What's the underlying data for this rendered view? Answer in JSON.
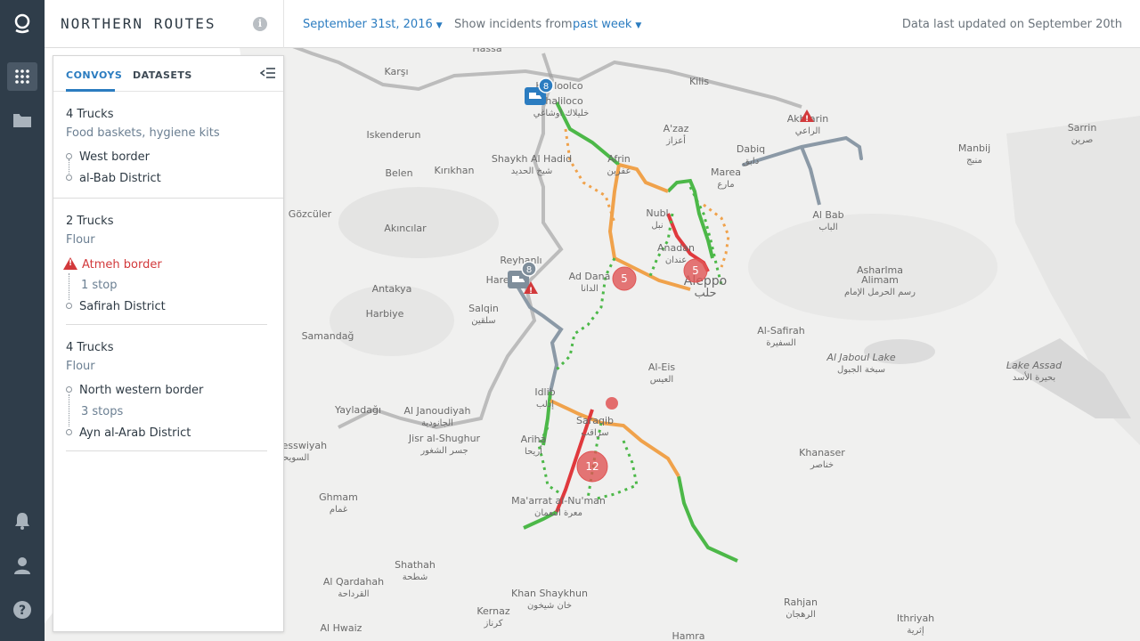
{
  "app": {
    "title": "NORTHERN ROUTES",
    "date_filter": "September 31st, 2016",
    "incidents_label": "Show incidents from",
    "incidents_filter": "past week",
    "last_updated": "Data last updated on September 20th"
  },
  "rail": {
    "items": [
      {
        "name": "logo-icon"
      },
      {
        "name": "grid-icon",
        "active": true
      },
      {
        "name": "folder-icon"
      },
      {
        "name": "bell-icon"
      },
      {
        "name": "user-icon"
      },
      {
        "name": "help-icon"
      }
    ]
  },
  "panel": {
    "tabs": [
      "CONVOYS",
      "DATASETS"
    ],
    "active_tab": "CONVOYS",
    "convoys": [
      {
        "trucks": "4 Trucks",
        "cargo": "Food baskets, hygiene kits",
        "from": "West border",
        "stops": "",
        "to": "al-Bab District",
        "alert": false
      },
      {
        "trucks": "2 Trucks",
        "cargo": "Flour",
        "from": "Atmeh border",
        "stops": "1 stop",
        "to": "Safirah District",
        "alert": true
      },
      {
        "trucks": "4 Trucks",
        "cargo": "Flour",
        "from": "North western border",
        "stops": "3 stops",
        "to": "Ayn al-Arab District",
        "alert": false
      }
    ]
  },
  "map": {
    "places": [
      {
        "en": "Hassa",
        "ar": ""
      },
      {
        "en": "Kholoolco",
        "ar": ""
      },
      {
        "en": "Khaliloco",
        "ar": "خلیلاك اوشاغي"
      },
      {
        "en": "Kilis",
        "ar": ""
      },
      {
        "en": "Karşı",
        "ar": ""
      },
      {
        "en": "Iskenderun",
        "ar": ""
      },
      {
        "en": "Belen",
        "ar": ""
      },
      {
        "en": "Kırıkhan",
        "ar": ""
      },
      {
        "en": "Gözcüler",
        "ar": ""
      },
      {
        "en": "Akıncılar",
        "ar": ""
      },
      {
        "en": "Antakya",
        "ar": ""
      },
      {
        "en": "Harbiye",
        "ar": ""
      },
      {
        "en": "Samandağ",
        "ar": ""
      },
      {
        "en": "Yayladağı",
        "ar": ""
      },
      {
        "en": "Shaykh Al Hadid",
        "ar": "شيخ الحديد"
      },
      {
        "en": "Afrin",
        "ar": "عفرين"
      },
      {
        "en": "A'zaz",
        "ar": "أعزاز"
      },
      {
        "en": "Marea",
        "ar": "مارع"
      },
      {
        "en": "Dabiq",
        "ar": "دابق"
      },
      {
        "en": "Akhtarin",
        "ar": "الراعي"
      },
      {
        "en": "Manbij",
        "ar": "منبج"
      },
      {
        "en": "Sarrin",
        "ar": "صرين"
      },
      {
        "en": "Al Bab",
        "ar": "الباب"
      },
      {
        "en": "Nubl",
        "ar": "نبل"
      },
      {
        "en": "Anadan",
        "ar": "عندان"
      },
      {
        "en": "Aleppo",
        "ar": "حلب"
      },
      {
        "en": "Ad Dana",
        "ar": "الدانا"
      },
      {
        "en": "Reyhanlı",
        "ar": ""
      },
      {
        "en": "Harem",
        "ar": ""
      },
      {
        "en": "Salqin",
        "ar": "سلقين"
      },
      {
        "en": "Al-Safirah",
        "ar": "السفيرة"
      },
      {
        "en": "Al-Eis",
        "ar": "العيس"
      },
      {
        "en": "Al Jaboul Lake",
        "ar": "سبخة الجبول"
      },
      {
        "en": "Lake Assad",
        "ar": "بحيرة الأسد"
      },
      {
        "en": "Idlib",
        "ar": "إدلب"
      },
      {
        "en": "Saraqib",
        "ar": "سراقب"
      },
      {
        "en": "Ariha",
        "ar": "أريحا"
      },
      {
        "en": "Al Janoudiyah",
        "ar": "الجانودية"
      },
      {
        "en": "Jisr al-Shughur",
        "ar": "جسر الشغور"
      },
      {
        "en": "Khanaser",
        "ar": "خناصر"
      },
      {
        "en": "Ghmam",
        "ar": "غمام"
      },
      {
        "en": "Ma'arrat al-Nu'man",
        "ar": "معرة النعمان"
      },
      {
        "en": "Shathah",
        "ar": "شطحة"
      },
      {
        "en": "Al Qardahah",
        "ar": "القرداحة"
      },
      {
        "en": "Khan Shaykhun",
        "ar": "خان شيخون"
      },
      {
        "en": "Kernaz",
        "ar": "كرناز"
      },
      {
        "en": "Rahjan",
        "ar": "الرهجان"
      },
      {
        "en": "Ithriyah",
        "ar": "إثرية"
      },
      {
        "en": "Al Hwaiz",
        "ar": ""
      },
      {
        "en": "Hamra",
        "ar": ""
      },
      {
        "en": "Sehlesswiyah",
        "ar": "السويحة"
      },
      {
        "en": "Asharlma",
        "ar": ""
      },
      {
        "en": "Alimam",
        "ar": "رسم الحرمل الإمام"
      }
    ],
    "cluster_markers": [
      {
        "count": "5",
        "color": "#e05555"
      },
      {
        "count": "5",
        "color": "#e05555"
      },
      {
        "count": "12",
        "color": "#e05555"
      }
    ],
    "convoy_markers": [
      {
        "count": "8",
        "color": "#2b7cc0"
      },
      {
        "count": "8",
        "color": "#7f8e9b"
      }
    ],
    "route_colors": {
      "good": "#4cb848",
      "medium": "#f0a24b",
      "bad": "#e0393d",
      "neutral": "#8b99a6"
    }
  }
}
